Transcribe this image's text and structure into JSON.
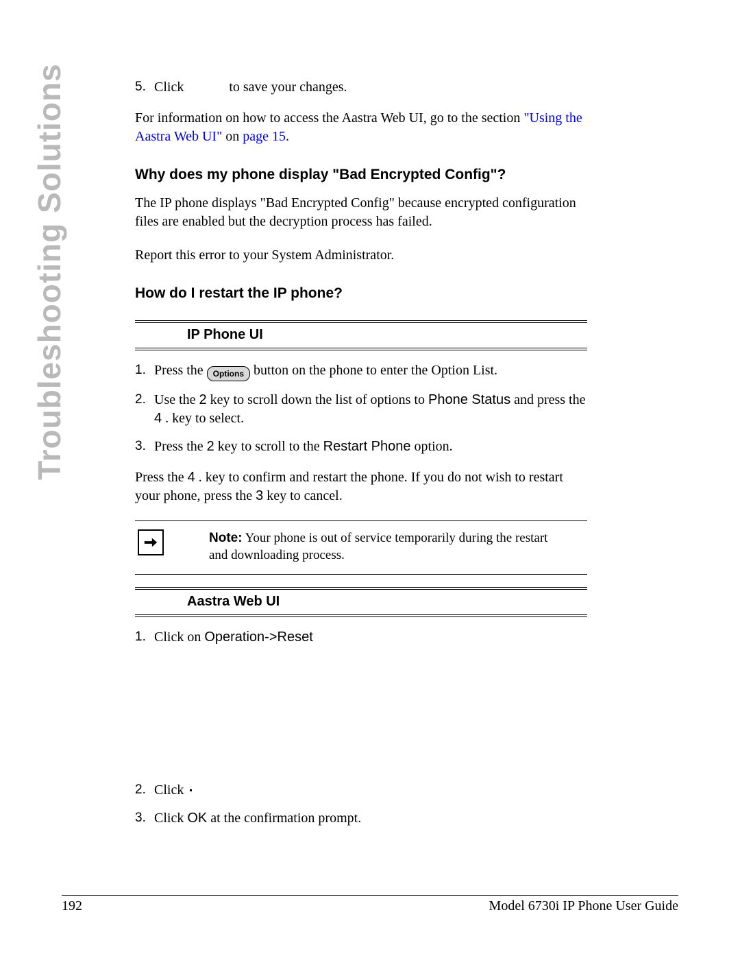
{
  "side_label": "Troubleshooting Solutions",
  "step5": {
    "marker": "5.",
    "pre": "Click ",
    "post": " to save your changes."
  },
  "para1": {
    "pre": "For information on how to access the Aastra Web UI, go to the section ",
    "link1": "\"Using the Aastra Web UI\"",
    "mid": " on ",
    "link2": "page 15",
    "post": "."
  },
  "heading1": "Why does my phone display \"Bad Encrypted Config\"?",
  "para2": "The IP phone displays \"Bad Encrypted Config\" because encrypted configuration files are enabled but the decryption process has failed.",
  "para3": "Report this error to your System Administrator.",
  "heading2": "How do I restart the IP phone?",
  "section1_title": "IP Phone UI",
  "ipsteps": {
    "s1": {
      "marker": "1.",
      "pre": "Press the ",
      "btn": "Options",
      "post": " button on the phone to enter the Option List."
    },
    "s2": {
      "marker": "2.",
      "t1": "Use the ",
      "k1": "2",
      "t2": " key to scroll down the list of options to ",
      "ph": "Phone Status",
      "t3": " and press the ",
      "k2": "4",
      "t4": " . key to select."
    },
    "s3": {
      "marker": "3.",
      "t1": "Press the ",
      "k1": "2",
      "t2": " key to scroll to the ",
      "ph": "Restart Phone",
      "t3": " option."
    }
  },
  "para4": {
    "t1": "Press the ",
    "k1": "4",
    "t2": " . key to confirm and restart the phone. If you do not wish to restart your phone, press the ",
    "k2": "3",
    "t3": "  key to cancel."
  },
  "note": {
    "label": "Note:",
    "text": " Your phone is out of service temporarily during the restart and downloading process."
  },
  "section2_title": "Aastra Web UI",
  "websteps": {
    "s1": {
      "marker": "1.",
      "t1": "Click on ",
      "op": "Operation->Reset"
    },
    "s2": {
      "marker": "2.",
      "t1": "Click "
    },
    "s3": {
      "marker": "3.",
      "t1": "Click ",
      "ok": "OK",
      "t2": " at the confirmation prompt."
    }
  },
  "footer": {
    "page": "192",
    "title": "Model 6730i IP Phone User Guide"
  }
}
